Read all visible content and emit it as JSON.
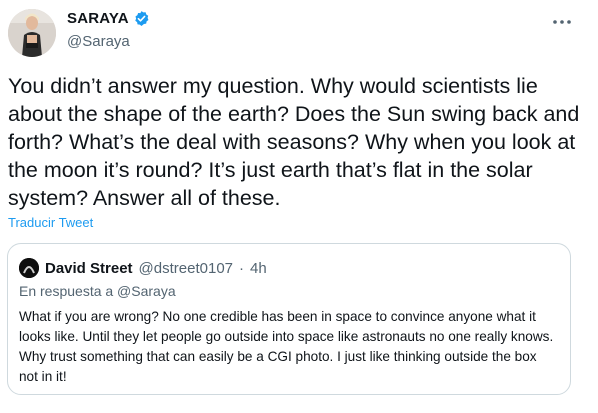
{
  "author": {
    "display_name": "SARAYA",
    "handle": "@Saraya",
    "verified_icon": "verified-badge-icon",
    "verified_color": "#1d9bf0"
  },
  "tweet": {
    "text": "You didn’t answer my question. Why would scientists lie about the shape of the earth? Does the Sun swing back and forth? What’s the deal with seasons? Why when you look at the moon it’s round? It’s just earth that’s flat in the solar system? Answer all of these.",
    "translate_label": "Traducir Tweet"
  },
  "quote": {
    "display_name": "David Street",
    "handle": "@dstreet0107",
    "separator": "·",
    "time": "4h",
    "reply_context": "En respuesta a @Saraya",
    "text": "What if you are wrong? No one credible has been in space to convince anyone what it looks like. Until they let people go outside into space like astronauts no one really knows. Why trust something that can easily be a CGI photo. I just like thinking outside the box not in it!"
  },
  "colors": {
    "link": "#1d9bf0",
    "secondary_text": "#536471",
    "border": "#cfd9de"
  }
}
